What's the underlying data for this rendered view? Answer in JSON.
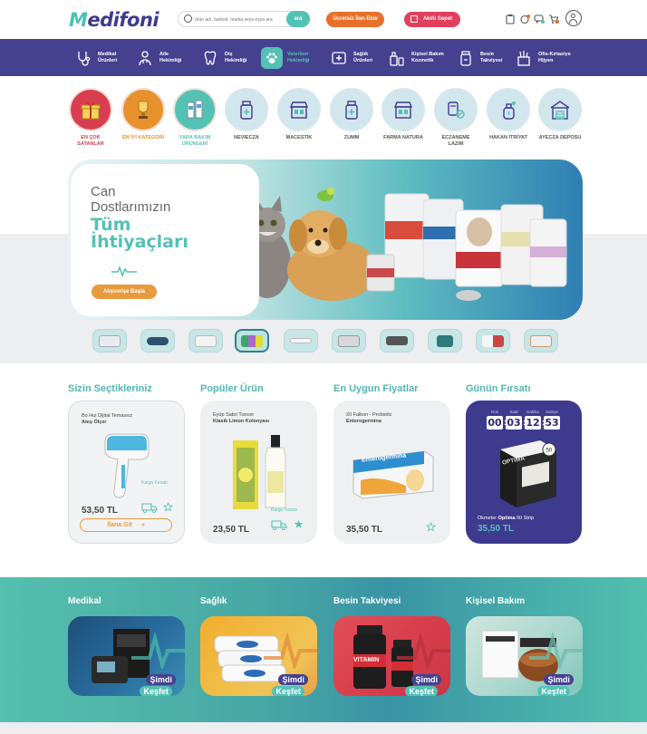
{
  "header": {
    "logo": {
      "prefix": "M",
      "rest": "edifoni"
    },
    "search": {
      "placeholder": "ürün adı, barkod, marka veya eşya ara",
      "button": "ara"
    },
    "free_listing": "Ücretsiz İlan Ekle",
    "smart_cart": "Akıllı Sepet",
    "icons": [
      "clipboard-icon",
      "alarm-icon",
      "chat-icon",
      "cart-icon",
      "user-icon"
    ]
  },
  "nav": [
    {
      "label": "Medikal Ürünleri",
      "icon": "stethoscope-icon"
    },
    {
      "label": "Aile Hekimliği",
      "icon": "doctor-icon"
    },
    {
      "label": "Diş Hekimliği",
      "icon": "tooth-icon"
    },
    {
      "label": "Veteriner Hekimliği",
      "icon": "paw-icon",
      "active": true
    },
    {
      "label": "Sağlık Ürünleri",
      "icon": "health-cross-icon"
    },
    {
      "label": "Kişisel Bakım Kozmetik",
      "icon": "cosmetic-icon"
    },
    {
      "label": "Besin Takviyesi",
      "icon": "supplement-icon"
    },
    {
      "label": "Ofis-Kırtasiye Hijyen",
      "icon": "office-icon"
    }
  ],
  "categories": [
    {
      "label": "EN ÇOK SATANLAR",
      "color": "#d93e50",
      "label_color": "#d93e50",
      "icon": "gift-icon"
    },
    {
      "label": "EN İYİ KATEGORİ",
      "color": "#e8922e",
      "label_color": "#e8922e",
      "icon": "trophy-icon"
    },
    {
      "label": "YARA BAKIM ÜRÜNLERİ",
      "color": "#53c2b5",
      "label_color": "#53c2b5",
      "icon": "bandage-icon"
    },
    {
      "label": "NEVIECZA",
      "icon": "pharmacy-icon"
    },
    {
      "label": "MACESTİK",
      "icon": "store-icon"
    },
    {
      "label": "ZUMM",
      "icon": "pharmacy-icon"
    },
    {
      "label": "FARMA NATURA",
      "icon": "store-icon"
    },
    {
      "label": "ECZANEME LAZIM",
      "icon": "pills-icon"
    },
    {
      "label": "HAKAN İTRİYAT",
      "icon": "perfume-icon"
    },
    {
      "label": "AYECZA DEPOSU",
      "icon": "warehouse-icon"
    }
  ],
  "hero": {
    "line1": "Can",
    "line2": "Dostlarımızın",
    "line3": "Tüm",
    "line4": "İhtiyaçları",
    "button": "Alışverişe Başla"
  },
  "sections": {
    "selected": "Sizin Seçtikleriniz",
    "popular": "Popüler Ürün",
    "cheapest": "En Uygun Fiyatlar",
    "deal": "Günün Fırsatı"
  },
  "products": [
    {
      "brand": "Bo Hui Dijital Temassız",
      "name": "Ateş Ölçer",
      "price": "53,50 TL",
      "cargo": "Kargo Fırsatı",
      "button": "İlana Git"
    },
    {
      "brand": "Eyüp Sabri Tuncer",
      "name": "Klasik Limon Kolonyası",
      "price": "23,50 TL",
      "cargo": "Kargo Fırsatı"
    },
    {
      "brand": "20 Falkon - Probiotic",
      "name": "Enterogermina",
      "price": "35,50 TL",
      "pack_text": "Enterogermina"
    }
  ],
  "deal": {
    "labels": [
      "Gün",
      "Saat",
      "Dakika",
      "Saniye"
    ],
    "values": [
      "00",
      "03",
      "12",
      "53"
    ],
    "brand": "Okmeter",
    "name": "Optima",
    "suffix": "50 Strip",
    "price": "35,50 TL",
    "box_text": "OPTIMA"
  },
  "bottom": [
    {
      "title": "Medikal",
      "cta1": "Şimdi",
      "cta2": "Keşfet"
    },
    {
      "title": "Sağlık",
      "cta1": "Şimdi",
      "cta2": "Keşfet"
    },
    {
      "title": "Besin Takviyesi",
      "cta1": "Şimdi",
      "cta2": "Keşfet",
      "product_text": "VITAMIN"
    },
    {
      "title": "Kişisel Bakım",
      "cta1": "Şimdi",
      "cta2": "Keşfet"
    }
  ],
  "colors": {
    "brand_purple": "#45418f",
    "accent_teal": "#53c2b5",
    "orange": "#e8702a",
    "pink": "#e0405c"
  }
}
